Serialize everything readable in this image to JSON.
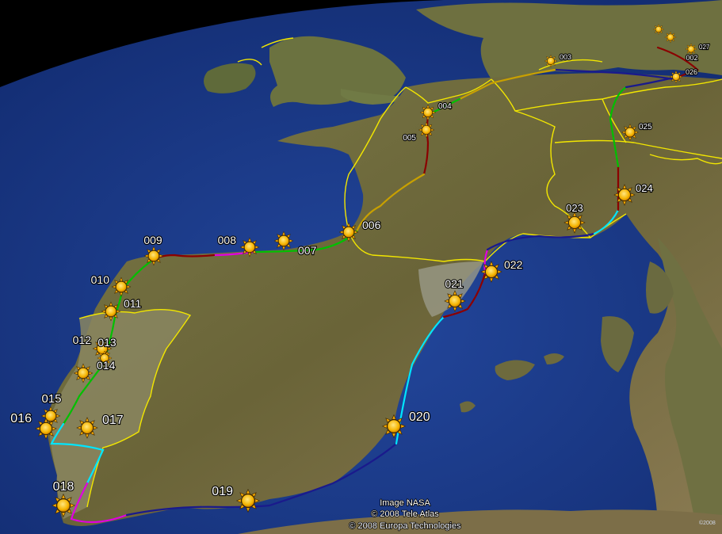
{
  "map": {
    "attribution": [
      "Image NASA",
      "© 2008 Tele Atlas",
      "© 2008 Europa Technologies"
    ],
    "corner_mark": "©2008",
    "icon": "sun-icon",
    "colors": {
      "ocean": "#1a3a8a",
      "land": "#6b6a3c",
      "border": "#f2e600",
      "route_segments": [
        "#8b0000",
        "#1a1a8c",
        "#00e5ff",
        "#e000e0",
        "#00c000",
        "#c8a000"
      ]
    },
    "markers": [
      {
        "id": "002",
        "label": "002"
      },
      {
        "id": "003",
        "label": "003"
      },
      {
        "id": "004",
        "label": "004"
      },
      {
        "id": "005",
        "label": "005"
      },
      {
        "id": "006",
        "label": "006"
      },
      {
        "id": "007",
        "label": "007"
      },
      {
        "id": "008",
        "label": "008"
      },
      {
        "id": "009",
        "label": "009"
      },
      {
        "id": "010",
        "label": "010"
      },
      {
        "id": "011",
        "label": "011"
      },
      {
        "id": "012",
        "label": "012"
      },
      {
        "id": "013",
        "label": "013"
      },
      {
        "id": "014",
        "label": "014"
      },
      {
        "id": "015",
        "label": "015"
      },
      {
        "id": "016",
        "label": "016"
      },
      {
        "id": "017",
        "label": "017"
      },
      {
        "id": "018",
        "label": "018"
      },
      {
        "id": "019",
        "label": "019"
      },
      {
        "id": "020",
        "label": "020"
      },
      {
        "id": "021",
        "label": "021"
      },
      {
        "id": "022",
        "label": "022"
      },
      {
        "id": "023",
        "label": "023"
      },
      {
        "id": "024",
        "label": "024"
      },
      {
        "id": "025",
        "label": "025"
      },
      {
        "id": "026",
        "label": "026"
      },
      {
        "id": "027",
        "label": "027"
      }
    ]
  }
}
